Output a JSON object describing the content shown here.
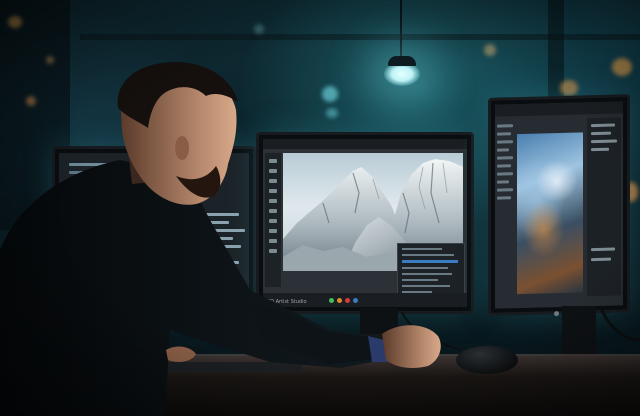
{
  "scene": {
    "description_type": "photo",
    "center_monitor": {
      "status_caption": "3D Artist Studio"
    },
    "colors": {
      "ambient_teal": "#2a9aa6",
      "lamp_glow": "#bff3f7",
      "shirt": "#0e1418",
      "skin": "#b88a6e",
      "hair": "#15100d"
    }
  }
}
